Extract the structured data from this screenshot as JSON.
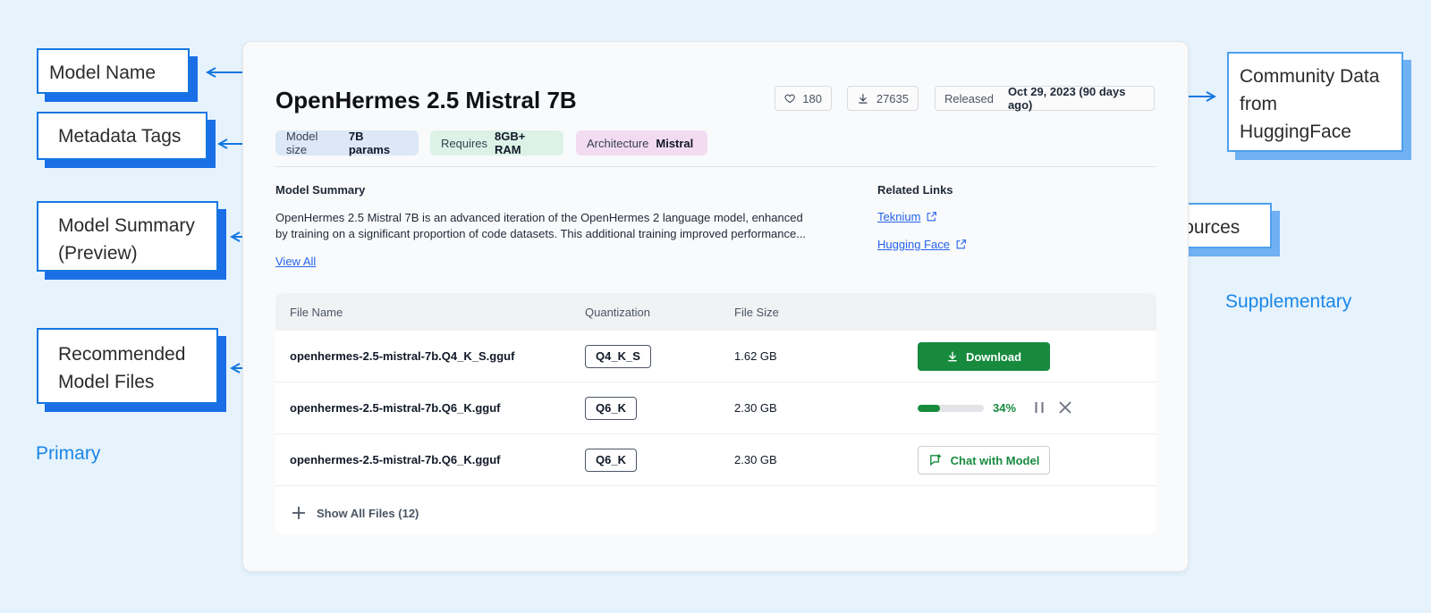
{
  "annotations": {
    "primary": [
      {
        "label": "Model Name"
      },
      {
        "label": "Metadata Tags"
      },
      {
        "label_lines": [
          "Model Summary",
          "(Preview)"
        ]
      },
      {
        "label_lines": [
          "Recommended",
          "Model Files"
        ]
      }
    ],
    "primary_section": "Primary",
    "supplementary": [
      {
        "label_lines": [
          "Community Data",
          "from",
          "HuggingFace"
        ]
      },
      {
        "label": "External Resources"
      }
    ],
    "supplementary_section": "Supplementary"
  },
  "model": {
    "name": "OpenHermes 2.5 Mistral 7B",
    "likes": "180",
    "downloads": "27635",
    "released_label": "Released",
    "released_value": "Oct 29, 2023 (90 days ago)",
    "tags": [
      {
        "key": "Model size",
        "value": "7B params",
        "color": "#dce8f7"
      },
      {
        "key": "Requires",
        "value": "8GB+ RAM",
        "color": "#dcf2e7"
      },
      {
        "key": "Architecture",
        "value": "Mistral",
        "color": "#f3dcf2"
      }
    ],
    "summary_heading": "Model Summary",
    "summary_lines": [
      "OpenHermes 2.5 Mistral 7B is an advanced iteration of the OpenHermes 2 language model, enhanced",
      "by training on a significant proportion of code datasets. This additional training improved performance..."
    ],
    "view_all": "View All",
    "related_heading": "Related Links",
    "links": [
      "Teknium",
      "Hugging Face"
    ]
  },
  "files": {
    "headers": [
      "File Name",
      "Quantization",
      "File Size"
    ],
    "rows": [
      {
        "name": "openhermes-2.5-mistral-7b.Q4_K_S.gguf",
        "quant": "Q4_K_S",
        "size": "1.62 GB",
        "action": "Download"
      },
      {
        "name": "openhermes-2.5-mistral-7b.Q6_K.gguf",
        "quant": "Q6_K",
        "size": "2.30 GB",
        "progress": 0.34,
        "progress_text": "34%"
      },
      {
        "name": "openhermes-2.5-mistral-7b.Q6_K.gguf",
        "quant": "Q6_K",
        "size": "2.30 GB",
        "action": "Chat with Model"
      }
    ],
    "show_all": "Show All Files (12)"
  },
  "colors": {
    "accent_green": "#178a3e",
    "callout_blue": "#1577e0",
    "section_blue": "#1a86e6",
    "background": "#e6f3fd"
  }
}
